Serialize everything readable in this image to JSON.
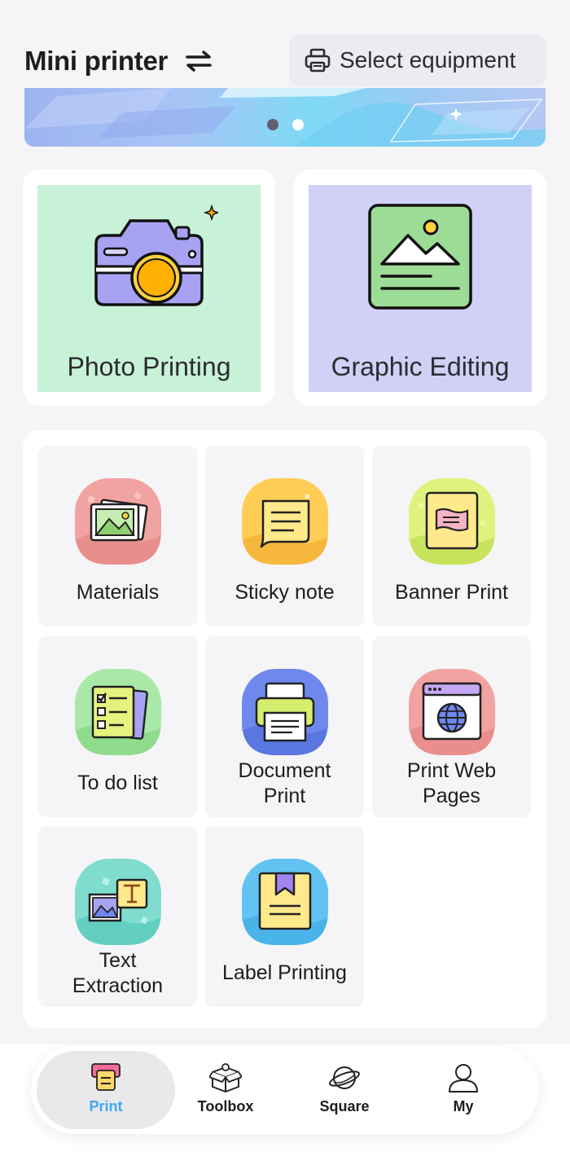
{
  "header": {
    "title": "Mini printer",
    "select_equipment_label": "Select equipment"
  },
  "banner": {
    "slide_count": 2,
    "active_slide": 2
  },
  "features": [
    {
      "label": "Photo Printing",
      "icon": "camera-icon",
      "bg": "#c8f2d8"
    },
    {
      "label": "Graphic Editing",
      "icon": "picture-icon",
      "bg": "#d1d0f7"
    }
  ],
  "tools": [
    {
      "label": "Materials",
      "icon": "materials-icon"
    },
    {
      "label": "Sticky note",
      "icon": "sticky-note-icon"
    },
    {
      "label": "Banner Print",
      "icon": "banner-icon"
    },
    {
      "label": "To do list",
      "icon": "todo-list-icon"
    },
    {
      "label": "Document Print",
      "line1": "Document",
      "line2": "Print",
      "icon": "document-printer-icon"
    },
    {
      "label": "Print Web Pages",
      "line1": "Print Web",
      "line2": "Pages",
      "icon": "web-page-icon"
    },
    {
      "label": "Text Extraction",
      "line1": "Text",
      "line2": "Extraction",
      "icon": "text-extraction-icon"
    },
    {
      "label": "Label Printing",
      "icon": "label-icon"
    }
  ],
  "tabbar": {
    "tabs": [
      {
        "label": "Print",
        "icon": "print-tab-icon",
        "active": true
      },
      {
        "label": "Toolbox",
        "icon": "toolbox-icon",
        "active": false
      },
      {
        "label": "Square",
        "icon": "square-planet-icon",
        "active": false
      },
      {
        "label": "My",
        "icon": "profile-icon",
        "active": false
      }
    ]
  },
  "colors": {
    "accent": "#3fa9ef",
    "background": "#f5f5f7"
  }
}
